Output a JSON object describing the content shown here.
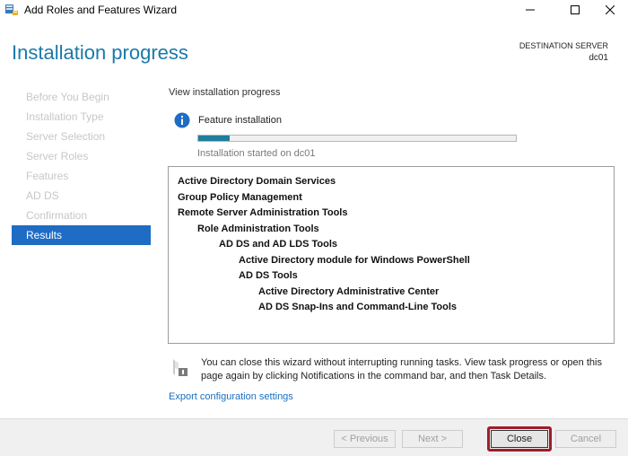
{
  "window": {
    "title": "Add Roles and Features Wizard",
    "app_icon": "server-manager-icon"
  },
  "header": {
    "page_title": "Installation progress",
    "destination_label": "DESTINATION SERVER",
    "destination_server": "dc01"
  },
  "nav": {
    "items": [
      {
        "label": "Before You Begin"
      },
      {
        "label": "Installation Type"
      },
      {
        "label": "Server Selection"
      },
      {
        "label": "Server Roles"
      },
      {
        "label": "Features"
      },
      {
        "label": "AD DS"
      },
      {
        "label": "Confirmation"
      },
      {
        "label": "Results"
      }
    ],
    "active_index": 7
  },
  "main": {
    "title": "View installation progress",
    "feature_label": "Feature installation",
    "progress_fraction": 0.1,
    "status": "Installation started on dc01",
    "results": [
      {
        "text": "Active Directory Domain Services",
        "level": 0
      },
      {
        "text": "Group Policy Management",
        "level": 0
      },
      {
        "text": "Remote Server Administration Tools",
        "level": 0
      },
      {
        "text": "Role Administration Tools",
        "level": 1
      },
      {
        "text": "AD DS and AD LDS Tools",
        "level": 2
      },
      {
        "text": "Active Directory module for Windows PowerShell",
        "level": 3
      },
      {
        "text": "AD DS Tools",
        "level": 3
      },
      {
        "text": "Active Directory Administrative Center",
        "level": 4
      },
      {
        "text": "AD DS Snap-Ins and Command-Line Tools",
        "level": 4
      }
    ],
    "note": "You can close this wizard without interrupting running tasks. View task progress or open this page again by clicking Notifications in the command bar, and then Task Details.",
    "export_link": "Export configuration settings"
  },
  "footer": {
    "previous": "< Previous",
    "next": "Next >",
    "close": "Close",
    "cancel": "Cancel"
  },
  "colors": {
    "accent_title": "#1a7aa8",
    "nav_active": "#1f6cc4",
    "progress_fill": "#1f7ea0",
    "close_highlight": "#9e1d2a"
  }
}
